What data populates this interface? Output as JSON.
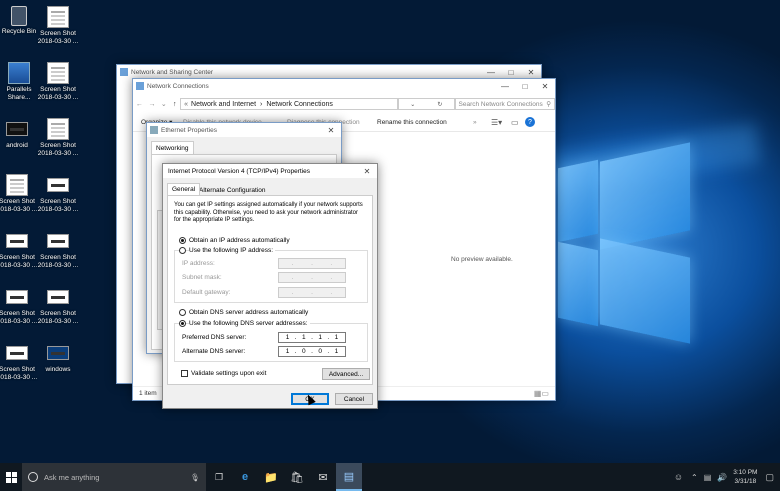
{
  "desktop": {
    "icons": [
      {
        "label": "Recycle Bin",
        "icon": "recycle-bin-icon"
      },
      {
        "label": "Screen Shot 2018-03-30 ...",
        "icon": "screenshot-file-icon"
      },
      {
        "label": "Parallels Share...",
        "icon": "parallels-icon"
      },
      {
        "label": "Screen Shot 2018-03-30 ...",
        "icon": "screenshot-file-icon"
      },
      {
        "label": "android",
        "icon": "android-file-icon"
      },
      {
        "label": "Screen Shot 2018-03-30 ...",
        "icon": "screenshot-file-icon"
      },
      {
        "label": "Screen Shot 2018-03-30 ...",
        "icon": "screenshot-file-icon"
      },
      {
        "label": "Screen Shot 2018-03-30 ...",
        "icon": "screenshot-file-icon"
      },
      {
        "label": "Screen Shot 2018-03-30 ...",
        "icon": "screenshot-file-icon"
      },
      {
        "label": "Screen Shot 2018-03-30 ...",
        "icon": "screenshot-file-icon"
      },
      {
        "label": "Screen Shot 2018-03-30 ...",
        "icon": "screenshot-file-icon"
      },
      {
        "label": "Screen Shot 2018-03-30 ...",
        "icon": "screenshot-file-icon"
      },
      {
        "label": "Screen Shot 2018-03-30 ...",
        "icon": "screenshot-file-icon"
      },
      {
        "label": "windows",
        "icon": "windows-file-icon"
      }
    ]
  },
  "nsc": {
    "title": "Network and Sharing Center"
  },
  "nc": {
    "title": "Network Connections",
    "breadcrumb": [
      "Network and Internet",
      "Network Connections"
    ],
    "search_placeholder": "Search Network Connections",
    "toolbar": {
      "organize": "Organize ▾",
      "disable": "Disable this network device",
      "diagnose": "Diagnose this connection",
      "rename": "Rename this connection"
    },
    "preview": "No preview available.",
    "status": "1 item"
  },
  "eth": {
    "title": "Ethernet Properties",
    "tab": "Networking"
  },
  "ipv4": {
    "title": "Internet Protocol Version 4 (TCP/IPv4) Properties",
    "tabs": [
      "General",
      "Alternate Configuration"
    ],
    "desc": "You can get IP settings assigned automatically if your network supports this capability. Otherwise, you need to ask your network administrator for the appropriate IP settings.",
    "obtain_ip": "Obtain an IP address automatically",
    "use_ip": "Use the following IP address:",
    "ip_label": "IP address:",
    "subnet_label": "Subnet mask:",
    "gateway_label": "Default gateway:",
    "obtain_dns": "Obtain DNS server address automatically",
    "use_dns": "Use the following DNS server addresses:",
    "pref_dns_label": "Preferred DNS server:",
    "alt_dns_label": "Alternate DNS server:",
    "pref_dns": [
      "1",
      "1",
      "1",
      "1"
    ],
    "alt_dns": [
      "1",
      "0",
      "0",
      "1"
    ],
    "validate": "Validate settings upon exit",
    "advanced": "Advanced...",
    "ok": "OK",
    "cancel": "Cancel"
  },
  "taskbar": {
    "search_placeholder": "Ask me anything",
    "time": "3:10 PM",
    "date": "3/31/18"
  }
}
